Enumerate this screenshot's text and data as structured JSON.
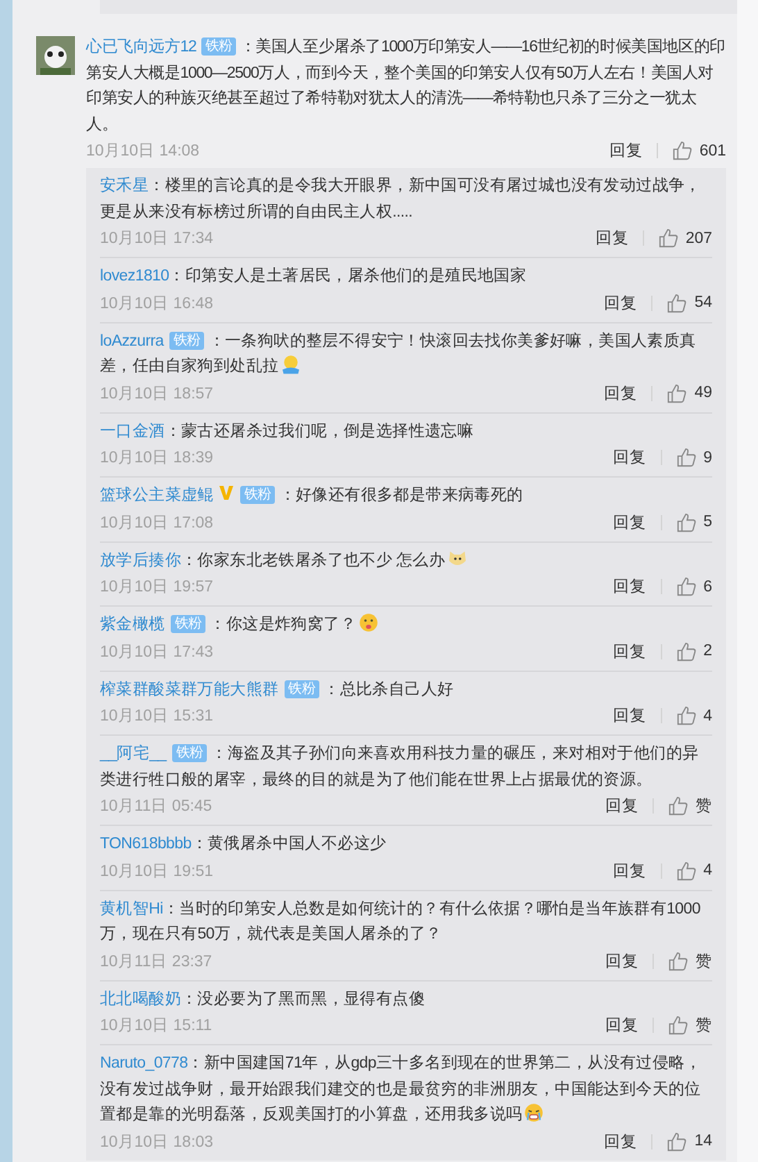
{
  "comment": {
    "author": "心已飞向远方12",
    "badge": "铁粉",
    "text": "：美国人至少屠杀了1000万印第安人——16世纪初的时候美国地区的印第安人大概是1000—2500万人，而到今天，整个美国的印第安人仅有50万人左右！美国人对印第安人的种族灭绝甚至超过了希特勒对犹太人的清洗——希特勒也只杀了三分之一犹太人。",
    "time": "10月10日 14:08",
    "reply_label": "回复",
    "likes": "601"
  },
  "replies": [
    {
      "author": "安禾星",
      "verified": false,
      "text": "：楼里的言论真的是令我大开眼界，新中国可没有屠过城也没有发动过战争，更是从来没有标榜过所谓的自由民主人权.....",
      "time": "10月10日 17:34",
      "reply_label": "回复",
      "likes": "207"
    },
    {
      "author": "lovez1810",
      "verified": false,
      "text": "：印第安人是土著居民，屠杀他们的是殖民地国家",
      "time": "10月10日 16:48",
      "reply_label": "回复",
      "likes": "54"
    },
    {
      "author": "loAzzurra",
      "badge": "铁粉",
      "verified": false,
      "text": "：一条狗吠的整层不得安宁！快滚回去找你美爹好嘛，美国人素质真差，任由自家狗到处乱拉",
      "emoji": {
        "kind": "hug"
      },
      "time": "10月10日 18:57",
      "reply_label": "回复",
      "likes": "49"
    },
    {
      "author": "一口金酒",
      "verified": false,
      "text": "：蒙古还屠杀过我们呢，倒是选择性遗忘嘛",
      "time": "10月10日 18:39",
      "reply_label": "回复",
      "likes": "9"
    },
    {
      "author": "篮球公主菜虚鲲",
      "badge": "铁粉",
      "verified": true,
      "text": "：好像还有很多都是带来病毒死的",
      "time": "10月10日 17:08",
      "reply_label": "回复",
      "likes": "5"
    },
    {
      "author": "放学后揍你",
      "verified": false,
      "text": "：你家东北老铁屠杀了也不少  怎么办",
      "emoji": {
        "kind": "doge"
      },
      "time": "10月10日 19:57",
      "reply_label": "回复",
      "likes": "6"
    },
    {
      "author": "紫金橄榄",
      "badge": "铁粉",
      "verified": false,
      "text": "：你这是炸狗窝了？",
      "emoji": {
        "kind": "tongue"
      },
      "time": "10月10日 17:43",
      "reply_label": "回复",
      "likes": "2"
    },
    {
      "author": "榨菜群酸菜群万能大熊群",
      "badge": "铁粉",
      "verified": false,
      "text": "：总比杀自己人好",
      "time": "10月10日 15:31",
      "reply_label": "回复",
      "likes": "4"
    },
    {
      "author": "__阿宅__",
      "badge": "铁粉",
      "verified": false,
      "text": "：海盗及其子孙们向来喜欢用科技力量的碾压，来对相对于他们的异类进行牲口般的屠宰，最终的目的就是为了他们能在世界上占据最优的资源。",
      "time": "10月11日 05:45",
      "reply_label": "回复",
      "likes": "赞"
    },
    {
      "author": "TON618bbbb",
      "verified": false,
      "text": "：黄俄屠杀中国人不必这少",
      "time": "10月10日 19:51",
      "reply_label": "回复",
      "likes": "4"
    },
    {
      "author": "黄机智Hi",
      "verified": false,
      "text": "：当时的印第安人总数是如何统计的？有什么依据？哪怕是当年族群有1000万，现在只有50万，就代表是美国人屠杀的了？",
      "time": "10月11日 23:37",
      "reply_label": "回复",
      "likes": "赞"
    },
    {
      "author": "北北喝酸奶",
      "verified": false,
      "text": "：没必要为了黑而黑，显得有点傻",
      "time": "10月10日 15:11",
      "reply_label": "回复",
      "likes": "赞"
    },
    {
      "author": "Naruto_0778",
      "verified": false,
      "text": "：新中国建国71年，从gdp三十多名到现在的世界第二，从没有过侵略，没有发过战争财，最开始跟我们建交的也是最贫穷的非洲朋友，中国能达到今天的位置都是靠的光明磊落，反观美国打的小算盘，还用我多说吗",
      "emoji": {
        "kind": "cry"
      },
      "time": "10月10日 18:03",
      "reply_label": "回复",
      "likes": "14"
    }
  ]
}
